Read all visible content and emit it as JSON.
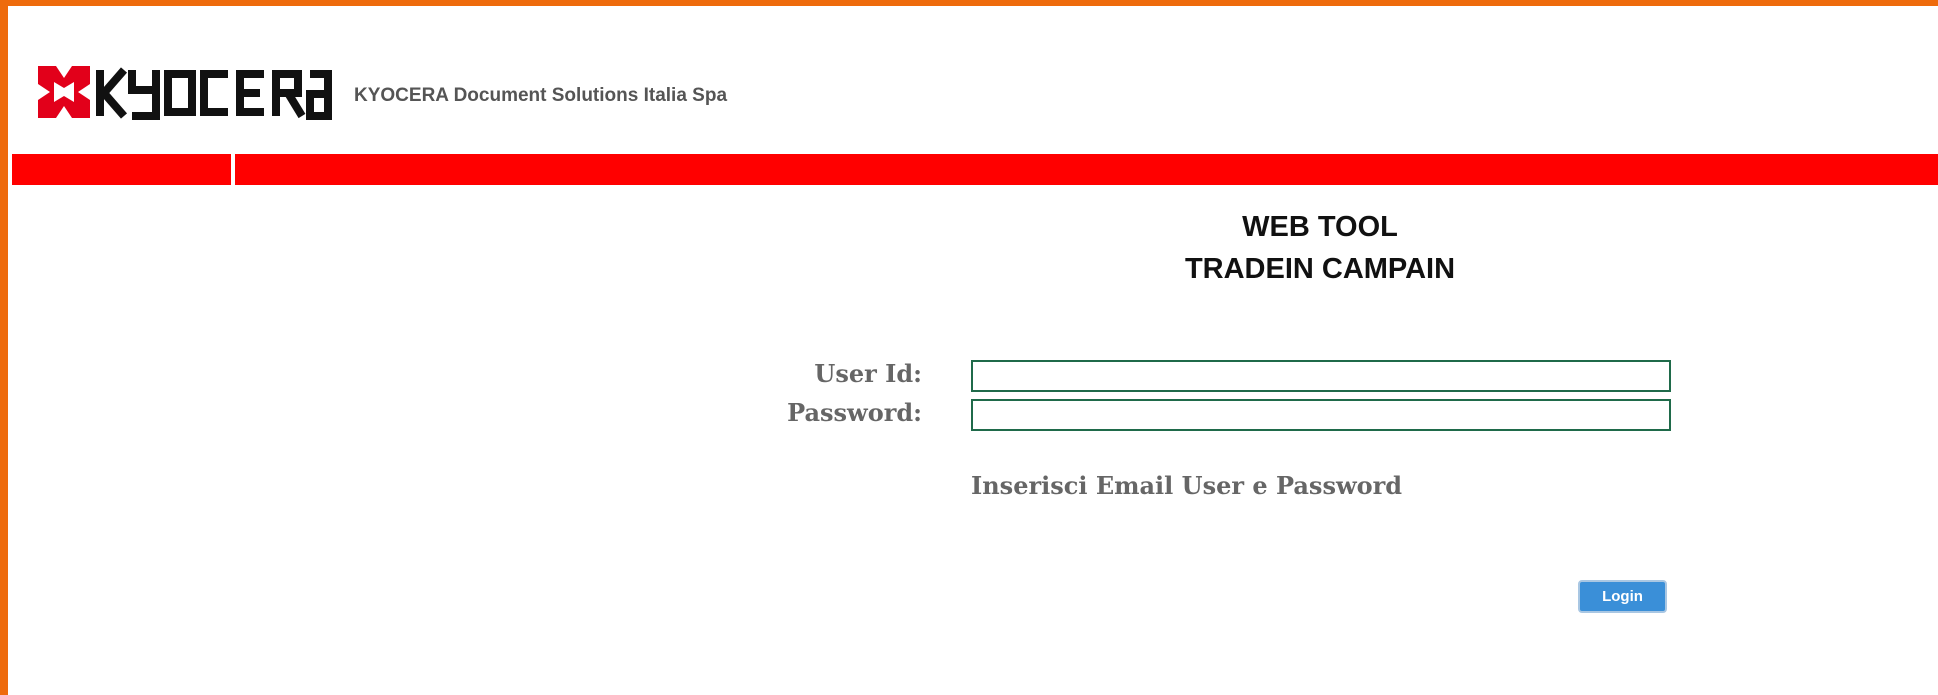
{
  "header": {
    "logo_text": "KYOCERA",
    "company_name": "KYOCERA Document Solutions Italia Spa"
  },
  "colors": {
    "frame": "#ee6b0c",
    "bar": "#ff0000",
    "logo": "#e2001a",
    "button": "#3a8fd8",
    "field_border": "#1f6a4a"
  },
  "login": {
    "title_line1": "WEB TOOL",
    "title_line2": "TRADEIN CAMPAIN",
    "user_label": "User Id:",
    "user_value": "",
    "password_label": "Password:",
    "password_value": "",
    "hint": "Inserisci Email User e Password",
    "button_label": "Login"
  }
}
